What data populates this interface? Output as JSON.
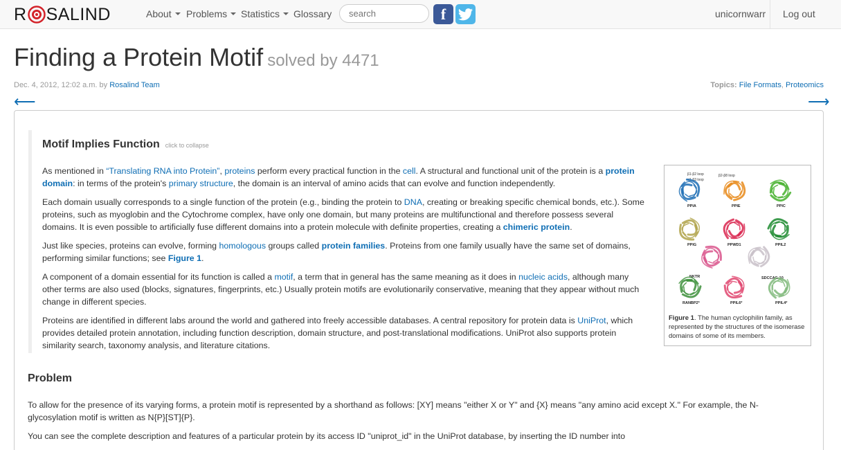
{
  "nav": {
    "logo_pre": "R",
    "logo_post": "SALIND",
    "about": "About",
    "problems": "Problems",
    "statistics": "Statistics",
    "glossary": "Glossary",
    "search_placeholder": "search",
    "facebook": "f",
    "twitter": "t",
    "username": "unicornwarr",
    "logout": "Log out"
  },
  "header": {
    "title": "Finding a Protein Motif",
    "solved": "solved by 4471",
    "date": "Dec. 4, 2012, 12:02 a.m. by ",
    "author": "Rosalind Team",
    "topics_label": "Topics:",
    "topic1": "File Formats",
    "topic_sep": ", ",
    "topic2": "Proteomics",
    "prev_arrow": "⟵",
    "next_arrow": "⟶"
  },
  "section": {
    "title": "Motif Implies Function",
    "collapse": "click to collapse"
  },
  "paragraphs": {
    "p1": {
      "t1": "As mentioned in ",
      "l1": "“Translating RNA into Protein”",
      "t2": ", ",
      "l2": "proteins",
      "t3": " perform every practical function in the ",
      "l3": "cell",
      "t4": ". A structural and functional unit of the protein is a ",
      "l4": "protein domain",
      "t5": ": in terms of the protein's ",
      "l5": "primary structure",
      "t6": ", the domain is an interval of amino acids that can evolve and function independently."
    },
    "p2": {
      "t1": "Each domain usually corresponds to a single function of the protein (e.g., binding the protein to ",
      "l1": "DNA",
      "t2": ", creating or breaking specific chemical bonds, etc.). Some proteins, such as myoglobin and the Cytochrome complex, have only one domain, but many proteins are multifunctional and therefore possess several domains. It is even possible to artificially fuse different domains into a protein molecule with definite properties, creating a ",
      "l2": "chimeric protein",
      "t3": "."
    },
    "p3": {
      "t1": "Just like species, proteins can evolve, forming ",
      "l1": "homologous",
      "t2": " groups called ",
      "l2": "protein families",
      "t3": ". Proteins from one family usually have the same set of domains, performing similar functions; see ",
      "l3": "Figure 1",
      "t4": "."
    },
    "p4": {
      "t1": "A component of a domain essential for its function is called a ",
      "l1": "motif",
      "t2": ", a term that in general has the same meaning as it does in ",
      "l2": "nucleic acids",
      "t3": ", although many other terms are also used (blocks, signatures, fingerprints, etc.) Usually protein motifs are evolutionarily conservative, meaning that they appear without much change in different species."
    },
    "p5": {
      "t1": "Proteins are identified in different labs around the world and gathered into freely accessible databases. A central repository for protein data is ",
      "l1": "UniProt",
      "t2": ", which provides detailed protein annotation, including function description, domain structure, and post-translational modifications. UniProt also supports protein similarity search, taxonomy analysis, and literature citations."
    }
  },
  "figure": {
    "labels": [
      "PPIA",
      "PPIE",
      "PPIC",
      "PPIG",
      "PPWD1",
      "PPIL2",
      "NKTR",
      "SDCCAG-10",
      "RANBP2*",
      "PPIL6*",
      "PPIL4*"
    ],
    "loop_labels": [
      "β1-β2 loop",
      "α1-β3 loop",
      "β2-β8 loop"
    ],
    "colors": [
      "#1f6fb5",
      "#e88a1a",
      "#44b02c",
      "#b0a34a",
      "#d9264f",
      "#1b8a2e",
      "#d9558c",
      "#c8c0c8",
      "#3c8f3a",
      "#e04770",
      "#7fb87a"
    ],
    "caption_label": "Figure 1",
    "caption_text": ". The human cyclophilin family, as represented by the structures of the isomerase domains of some of its members."
  },
  "problem": {
    "title": "Problem",
    "p1": "To allow for the presence of its varying forms, a protein motif is represented by a shorthand as follows: [XY] means \"either X or Y\" and {X} means \"any amino acid except X.\" For example, the N-glycosylation motif is written as N{P}[ST]{P}.",
    "p2": "You can see the complete description and features of a particular protein by its access ID \"uniprot_id\" in the UniProt database, by inserting the ID number into"
  }
}
